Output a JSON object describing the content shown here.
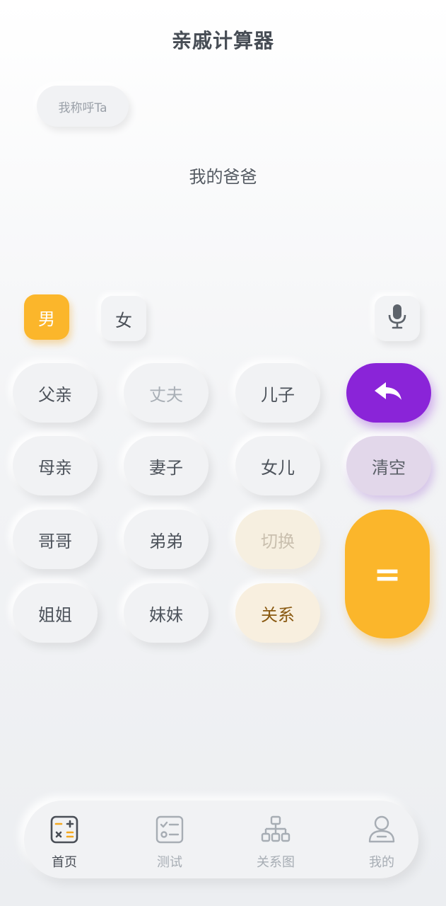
{
  "header": {
    "title": "亲戚计算器"
  },
  "call_button": {
    "label": "我称呼Ta"
  },
  "result": {
    "text": "我的爸爸"
  },
  "gender": {
    "male_label": "男",
    "female_label": "女",
    "selected": "男"
  },
  "keypad": {
    "row1": [
      "父亲",
      "丈夫",
      "儿子"
    ],
    "row2": [
      "母亲",
      "妻子",
      "女儿"
    ],
    "row3": [
      "哥哥",
      "弟弟",
      "切换"
    ],
    "row4": [
      "姐姐",
      "妹妹",
      "关系"
    ],
    "clear_label": "清空",
    "equals_label": "="
  },
  "tabbar": {
    "items": [
      {
        "label": "首页",
        "icon": "calculator-icon",
        "active": true
      },
      {
        "label": "测试",
        "icon": "checklist-icon",
        "active": false
      },
      {
        "label": "关系图",
        "icon": "hierarchy-icon",
        "active": false
      },
      {
        "label": "我的",
        "icon": "user-icon",
        "active": false
      }
    ]
  },
  "colors": {
    "accent_orange": "#fbb62b",
    "accent_purple": "#8a24d8",
    "clear_purple_light": "#e2d7ea"
  }
}
